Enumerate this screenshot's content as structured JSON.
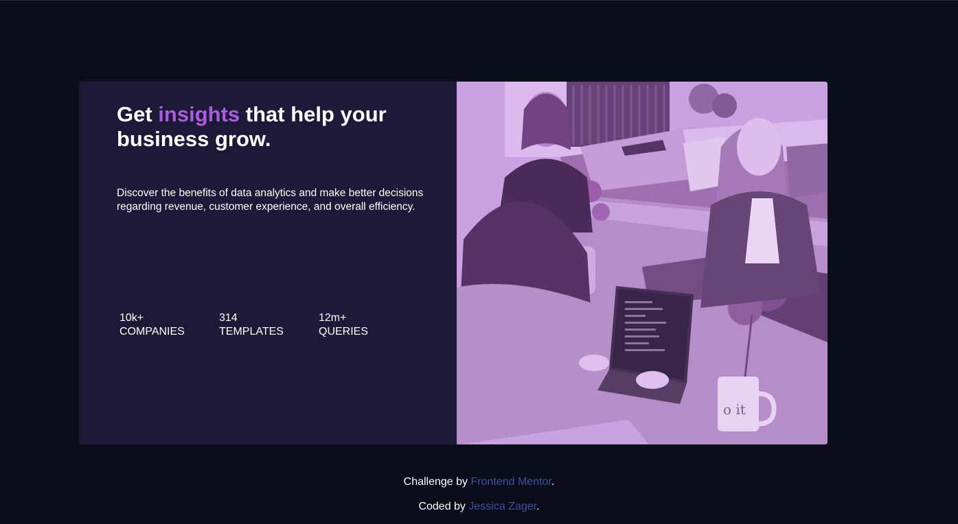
{
  "hero": {
    "headline_pre": "Get ",
    "headline_accent": "insights",
    "headline_post": " that help your business grow.",
    "description": "Discover the benefits of data analytics and make better decisions regarding revenue, customer experience, and overall efficiency."
  },
  "stats": [
    {
      "value": "10k+",
      "label": "COMPANIES"
    },
    {
      "value": "314",
      "label": "TEMPLATES"
    },
    {
      "value": "12m+",
      "label": "QUERIES"
    }
  ],
  "attribution": {
    "challenge_prefix": "Challenge by ",
    "challenge_link": "Frontend Mentor",
    "challenge_suffix": ".",
    "coded_prefix": "Coded by ",
    "coded_link": "Jessica Zager",
    "coded_suffix": "."
  },
  "colors": {
    "background": "#0b0d1a",
    "card": "#1c1a38",
    "accent": "#aa5cdb",
    "link": "#3e52a3",
    "photo_tint": "#c9a0dc"
  },
  "icons": {
    "photo": "office-team-photo"
  }
}
